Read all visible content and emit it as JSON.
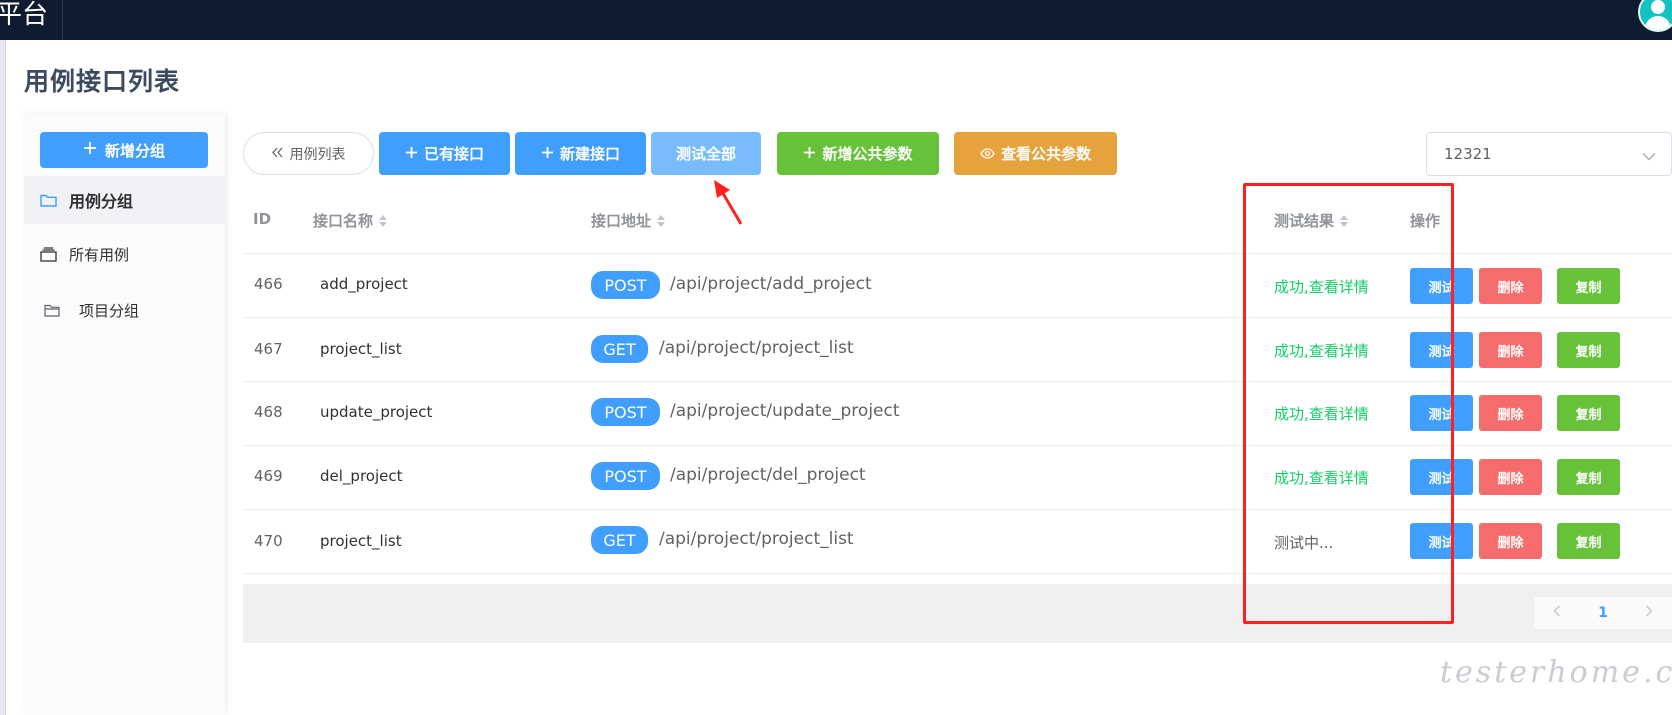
{
  "app": {
    "brand": "平台"
  },
  "page": {
    "title": "用例接口列表"
  },
  "sidebar": {
    "new_group_label": "新增分组",
    "items": [
      {
        "label": "用例分组",
        "icon": "folder-icon",
        "active": true
      },
      {
        "label": "所有用例",
        "icon": "stack-icon",
        "active": false
      },
      {
        "label": "项目分组",
        "icon": "folder-open-icon",
        "active": false
      }
    ]
  },
  "toolbar": {
    "back_label": "用例列表",
    "existing_label": "已有接口",
    "new_label": "新建接口",
    "test_all_label": "测试全部",
    "add_public_label": "新增公共参数",
    "view_public_label": "查看公共参数",
    "select_value": "12321"
  },
  "table": {
    "headers": {
      "id": "ID",
      "name": "接口名称",
      "url": "接口地址",
      "result": "测试结果",
      "actions": "操作"
    },
    "rows": [
      {
        "id": "466",
        "name": "add_project",
        "method": "POST",
        "path": "/api/project/add_project",
        "result": "成功,查看详情"
      },
      {
        "id": "467",
        "name": "project_list",
        "method": "GET",
        "path": "/api/project/project_list",
        "result": "成功,查看详情"
      },
      {
        "id": "468",
        "name": "update_project",
        "method": "POST",
        "path": "/api/project/update_project",
        "result": "成功,查看详情"
      },
      {
        "id": "469",
        "name": "del_project",
        "method": "POST",
        "path": "/api/project/del_project",
        "result": "成功,查看详情"
      },
      {
        "id": "470",
        "name": "project_list",
        "method": "GET",
        "path": "/api/project/project_list",
        "result": "测试中..."
      }
    ],
    "action_labels": {
      "test": "测试",
      "delete": "删除",
      "copy": "复制"
    }
  },
  "pagination": {
    "current_page": "1"
  },
  "watermark": "testerhome.com",
  "colors": {
    "primary": "#409eff",
    "success": "#67c23a",
    "warning": "#e6a23c",
    "danger": "#f56c6c",
    "result_success": "#13ce66"
  }
}
